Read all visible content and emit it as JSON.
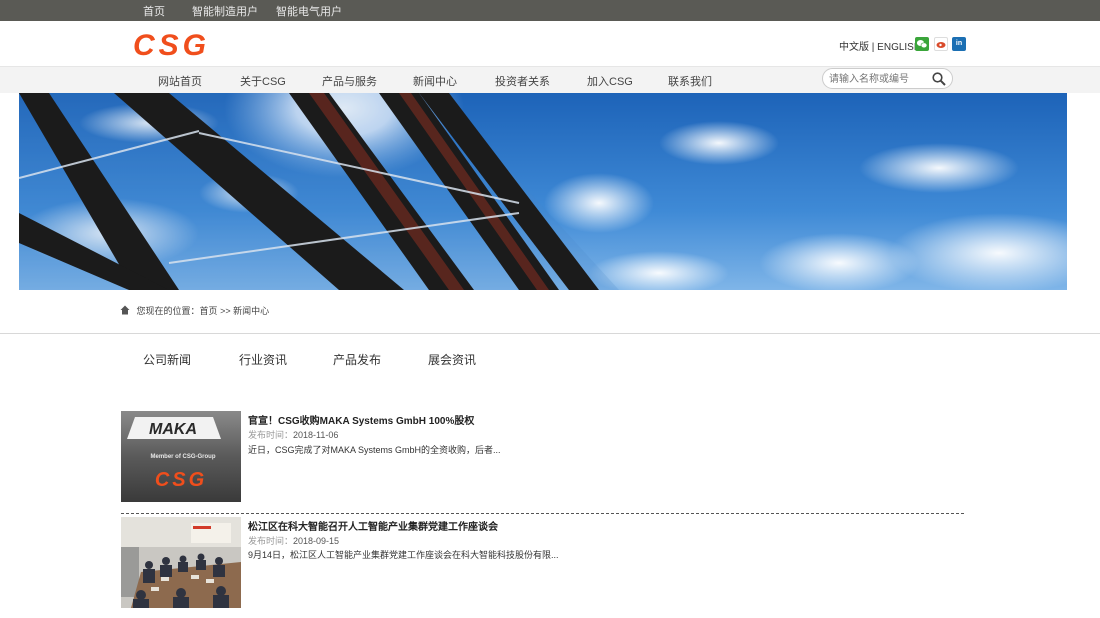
{
  "topbar": {
    "links": [
      "首页",
      "智能制造用户",
      "智能电气用户"
    ]
  },
  "header": {
    "logo_text": "CSG",
    "lang_cn": "中文版",
    "lang_sep": "|",
    "lang_en": "ENGLISH",
    "social": [
      {
        "icon": "wechat-icon",
        "color": "#3aa53a"
      },
      {
        "icon": "weibo-icon",
        "color": "#d94b2b"
      },
      {
        "icon": "linkedin-icon",
        "color": "#1b6fb3",
        "glyph": "in"
      }
    ]
  },
  "nav": {
    "items": [
      "网站首页",
      "关于CSG",
      "产品与服务",
      "新闻中心",
      "投资者关系",
      "加入CSG",
      "联系我们"
    ],
    "search_placeholder": "请输入名称或编号"
  },
  "breadcrumb": {
    "prefix": "您现在的位置：",
    "home": "首页",
    "sep": ">>",
    "current": "新闻中心"
  },
  "tabs": [
    "公司新闻",
    "行业资讯",
    "产品发布",
    "展会资讯"
  ],
  "news": [
    {
      "title": "官宣！CSG收购MAKA Systems GmbH 100%股权",
      "date_label": "发布时间：",
      "date": "2018-11-06",
      "summary": "近日，CSG完成了对MAKA Systems GmbH的全资收购，后者...",
      "thumb_text_1": "MAKA",
      "thumb_text_2": "Member of CSG-Group",
      "thumb_text_3": "CSG"
    },
    {
      "title": "松江区在科大智能召开人工智能产业集群党建工作座谈会",
      "date_label": "发布时间：",
      "date": "2018-09-15",
      "summary": "9月14日，松江区人工智能产业集群党建工作座谈会在科大智能科技股份有限..."
    }
  ],
  "colors": {
    "brand_orange": "#f04e1c",
    "topbar": "#5a5a55",
    "nav_bg": "#f3f3f3"
  }
}
